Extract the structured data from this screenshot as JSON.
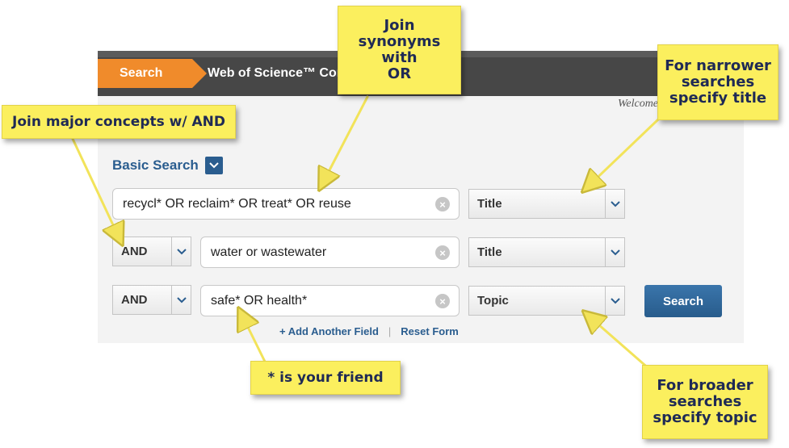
{
  "header": {
    "search_tab": "Search",
    "product_title": "Web of Science™ Core Collection",
    "welcome": "Welcome"
  },
  "basic_search": {
    "label": "Basic Search"
  },
  "rows": [
    {
      "operator": "",
      "query": "recycl* OR reclaim* OR treat* OR reuse",
      "field": "Title"
    },
    {
      "operator": "AND",
      "query": "water or wastewater",
      "field": "Title"
    },
    {
      "operator": "AND",
      "query": "safe* OR health*",
      "field": "Topic"
    }
  ],
  "actions": {
    "search_button": "Search",
    "add_field": "+ Add Another Field",
    "separator": "|",
    "reset_form": "Reset Form"
  },
  "callouts": {
    "join_synonyms": "Join\nsynonyms\nwith\nOR",
    "narrower": "For narrower\nsearches\nspecify title",
    "join_major": "Join major concepts w/ AND",
    "wildcard": "* is your friend",
    "broader": "For broader\nsearches\nspecify topic"
  },
  "colors": {
    "accent_orange": "#f08b2b",
    "link_blue": "#2a5d8f",
    "callout_yellow": "#fbef5e"
  },
  "icons": {
    "clear": "clear-circle-icon",
    "dropdown": "chevron-down-icon"
  }
}
